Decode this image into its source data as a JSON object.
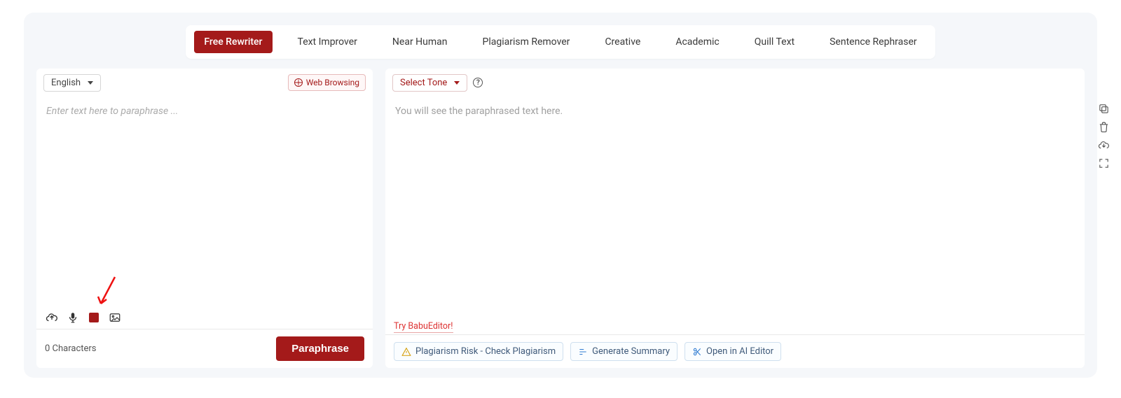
{
  "tabs": {
    "items": [
      "Free Rewriter",
      "Text Improver",
      "Near Human",
      "Plagiarism Remover",
      "Creative",
      "Academic",
      "Quill Text",
      "Sentence Rephraser"
    ],
    "active_index": 0
  },
  "left": {
    "language_label": "English",
    "web_browsing_label": "Web Browsing",
    "placeholder": "Enter text here to paraphrase ...",
    "char_count": "0 Characters",
    "paraphrase_label": "Paraphrase"
  },
  "right": {
    "tone_label": "Select Tone",
    "placeholder": "You will see the paraphrased text here.",
    "try_link": "Try BabuEditor!",
    "chip_plagiarism": "Plagiarism Risk - Check Plagiarism",
    "chip_summary": "Generate Summary",
    "chip_editor": "Open in AI Editor"
  },
  "icons": {
    "help_glyph": "?"
  }
}
